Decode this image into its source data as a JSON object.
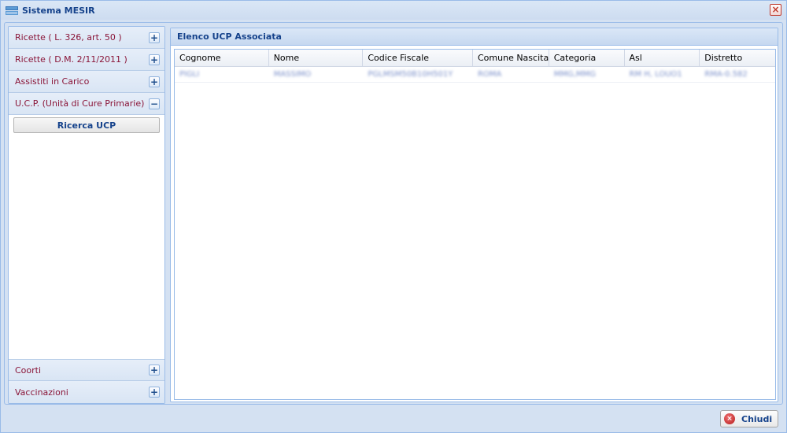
{
  "window": {
    "title": "Sistema MESIR"
  },
  "left_menu": {
    "items": [
      {
        "label": "Ricette ( L. 326, art. 50 )",
        "toggle": "+"
      },
      {
        "label": "Ricette ( D.M. 2/11/2011 )",
        "toggle": "+"
      },
      {
        "label": "Assistiti in Carico",
        "toggle": "+"
      },
      {
        "label": "U.C.P. (Unità di Cure Primarie)",
        "toggle": "−"
      }
    ],
    "open_section": {
      "button_label": "Ricerca UCP"
    },
    "bottom_items": [
      {
        "label": "Coorti",
        "toggle": "+"
      },
      {
        "label": "Vaccinazioni",
        "toggle": "+"
      }
    ]
  },
  "panel": {
    "title": "Elenco UCP Associata",
    "columns": [
      "Cognome",
      "Nome",
      "Codice Fiscale",
      "Comune Nascita",
      "Categoria",
      "Asl",
      "Distretto"
    ],
    "rows": [
      [
        "PIGLI",
        "MASSIMO",
        "PGLMSM50B10H501Y",
        "ROMA",
        "MMG,MMG",
        "RM H, LOUO1",
        "RMA-0.582"
      ]
    ]
  },
  "footer": {
    "close_label": "Chiudi"
  },
  "colors": {
    "accent": "#15428b",
    "menu_text": "#8a1538",
    "border": "#99bbe8"
  },
  "icons": {
    "app": "window-icon",
    "close": "close-icon",
    "chiudi": "close-circle-icon"
  }
}
